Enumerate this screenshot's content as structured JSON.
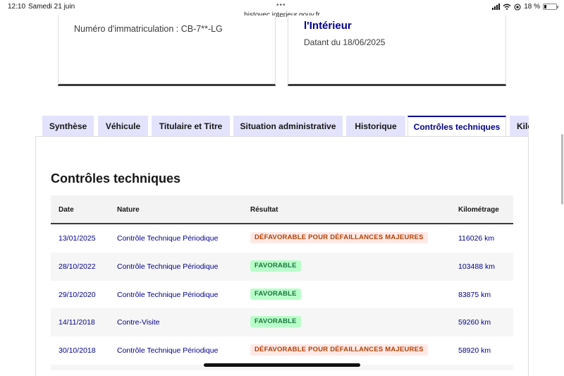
{
  "status_bar": {
    "time": "12:10",
    "date": "Samedi 21 juin",
    "url": "histovec.interieur.gouv.fr",
    "battery": "18 %",
    "battery_level": 0.18
  },
  "cards": {
    "card1_text": "Numéro d'immatriculation : CB-7**-LG",
    "card2_title": "l'Intérieur",
    "card2_date": "Datant du 18/06/2025"
  },
  "tabs": [
    {
      "label": "Synthèse"
    },
    {
      "label": "Véhicule"
    },
    {
      "label": "Titulaire et Titre"
    },
    {
      "label": "Situation administrative"
    },
    {
      "label": "Historique"
    },
    {
      "label": "Contrôles techniques"
    },
    {
      "label": "Kilométrage"
    }
  ],
  "section": {
    "title": "Contrôles techniques",
    "columns": [
      "Date",
      "Nature",
      "Résultat",
      "Kilométrage"
    ],
    "rows": [
      {
        "date": "13/01/2025",
        "nature": "Contrôle Technique Périodique",
        "result": "DÉFAVORABLE POUR DÉFAILLANCES MAJEURES",
        "result_status": "bad",
        "km": "116026 km"
      },
      {
        "date": "28/10/2022",
        "nature": "Contrôle Technique Périodique",
        "result": "FAVORABLE",
        "result_status": "good",
        "km": "103488 km"
      },
      {
        "date": "29/10/2020",
        "nature": "Contrôle Technique Périodique",
        "result": "FAVORABLE",
        "result_status": "good",
        "km": "83875 km"
      },
      {
        "date": "14/11/2018",
        "nature": "Contre-Visite",
        "result": "FAVORABLE",
        "result_status": "good",
        "km": "59260 km"
      },
      {
        "date": "30/10/2018",
        "nature": "Contrôle Technique Périodique",
        "result": "DÉFAVORABLE POUR DÉFAILLANCES MAJEURES",
        "result_status": "bad",
        "km": "58920 km"
      }
    ]
  },
  "colors": {
    "primary": "#000091",
    "tab_bg": "#e3e3fd",
    "bad_bg": "#ffe9e6",
    "bad_text": "#b34000",
    "good_bg": "#b8fec9",
    "good_text": "#18753c"
  }
}
